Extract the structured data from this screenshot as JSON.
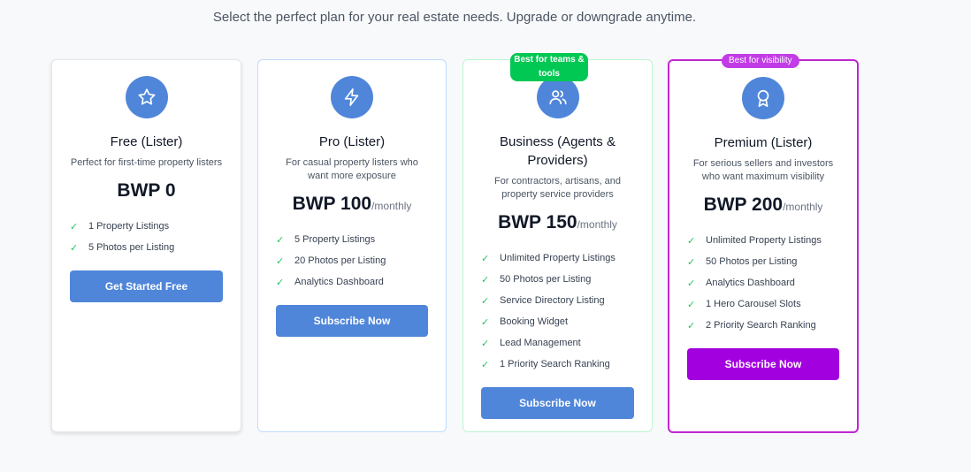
{
  "header": {
    "subtitle": "Select the perfect plan for your real estate needs. Upgrade or downgrade anytime."
  },
  "plans": [
    {
      "name": "Free (Lister)",
      "description": "Perfect for first-time property listers",
      "price": "BWP 0",
      "period": "",
      "icon": "star-icon",
      "features": [
        "1 Property Listings",
        "5 Photos per Listing"
      ],
      "button": "Get Started Free"
    },
    {
      "name": "Pro (Lister)",
      "description": "For casual property listers who want more exposure",
      "price": "BWP 100",
      "period": "/monthly",
      "icon": "lightning-icon",
      "features": [
        "5 Property Listings",
        "20 Photos per Listing",
        "Analytics Dashboard"
      ],
      "button": "Subscribe Now"
    },
    {
      "name": "Business (Agents & Providers)",
      "description": "For contractors, artisans, and property service providers",
      "price": "BWP 150",
      "period": "/monthly",
      "icon": "users-icon",
      "badge": "Best for teams & tools",
      "features": [
        "Unlimited Property Listings",
        "50 Photos per Listing",
        "Service Directory Listing",
        "Booking Widget",
        "Lead Management",
        "1 Priority Search Ranking"
      ],
      "button": "Subscribe Now"
    },
    {
      "name": "Premium (Lister)",
      "description": "For serious sellers and investors who want maximum visibility",
      "price": "BWP 200",
      "period": "/monthly",
      "icon": "award-icon",
      "badge": "Best for visibility",
      "features": [
        "Unlimited Property Listings",
        "50 Photos per Listing",
        "Analytics Dashboard",
        "1 Hero Carousel Slots",
        "2 Priority Search Ranking"
      ],
      "button": "Subscribe Now"
    }
  ],
  "colors": {
    "primary": "#4f86da",
    "premium_button": "#a300e0",
    "premium_border": "#c026d3",
    "teams_badge": "#00c853",
    "visibility_badge": "#c13ce6",
    "check": "#22c55e"
  }
}
